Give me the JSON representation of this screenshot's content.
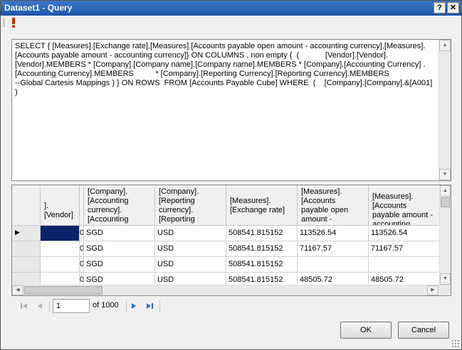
{
  "window": {
    "title": "Dataset1 - Query",
    "help_glyph": "?",
    "close_glyph": "✕"
  },
  "toolbar": {
    "run_icon": "exclamation-run-icon",
    "run_color": "#d03000"
  },
  "query": {
    "text": "SELECT { [Measures].[Exchange rate],[Measures].[Accounts payable open amount - accounting currency],[Measures].\n[Accounts payable amount - accounting currency]} ON COLUMNS , non empty {  (            [Vendor].[Vendor].\n[Vendor].MEMBERS * [Company].[Company name].[Company name].MEMBERS * [Company].[Accounting Currency] .\n[Accounting Currency].MEMBERS          * [Company].[Reporting Currency].[Reporting Currency].MEMBERS\n--Global Cartesis Mappings ) } ON ROWS  FROM [Accounts Payable Cube] WHERE  (    [Company].[Company].&[A001] )"
  },
  "grid": {
    "columns": [
      {
        "label": "].[Vendor]"
      },
      {
        "label": ""
      },
      {
        "label": "[Company].[Accounting currency].[Accounting currency].[MEMBER"
      },
      {
        "label": "[Company].[Reporting currency].[Reporting currency].[MEMBER"
      },
      {
        "label": "[Measures].[Exchange rate]"
      },
      {
        "label": "[Measures].[Accounts payable open amount - accounting"
      },
      {
        "label": "[Measures].[Accounts payable amount - accounting currency]"
      }
    ],
    "rows": [
      {
        "vendor": "",
        "c": "0",
        "acct": "SGD",
        "rep": "USD",
        "rate": "508541.815152",
        "open": "113526.54",
        "amount": "113526.54"
      },
      {
        "vendor": "",
        "c": "0",
        "acct": "SGD",
        "rep": "USD",
        "rate": "508541.815152",
        "open": "71167.57",
        "amount": "71167.57"
      },
      {
        "vendor": "",
        "c": "0",
        "acct": "SGD",
        "rep": "USD",
        "rate": "508541.815152",
        "open": "",
        "amount": ""
      },
      {
        "vendor": "",
        "c": "0",
        "acct": "SGD",
        "rep": "USD",
        "rate": "508541.815152",
        "open": "48505.72",
        "amount": "48505.72"
      }
    ],
    "current_row_marker": "▶",
    "selection_color": "#0a246a"
  },
  "navigator": {
    "position": "1",
    "of_label": "of 1000",
    "first_icon": "first-record-icon",
    "prev_icon": "previous-record-icon",
    "next_icon": "next-record-icon",
    "last_icon": "last-record-icon"
  },
  "buttons": {
    "ok": "OK",
    "cancel": "Cancel"
  }
}
